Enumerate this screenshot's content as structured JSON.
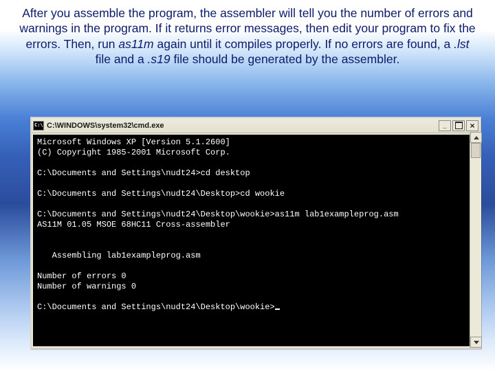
{
  "instruction": {
    "p1": "After you assemble the program, the assembler will tell you the number of errors and warnings in the program. If it returns error messages, then edit your program to fix the errors. Then, run ",
    "em1": "as11m",
    "p2": " again until it compiles properly. If no errors are found, a ",
    "em2": ".lst",
    "p3": " file and a ",
    "em3": ".s19",
    "p4": " file should be generated by the assembler."
  },
  "window": {
    "title": "C:\\WINDOWS\\system32\\cmd.exe",
    "buttons": {
      "min": "_",
      "close": "×"
    }
  },
  "terminal": {
    "l0": "Microsoft Windows XP [Version 5.1.2600]",
    "l1": "(C) Copyright 1985-2001 Microsoft Corp.",
    "l2": "C:\\Documents and Settings\\nudt24>cd desktop",
    "l3": "C:\\Documents and Settings\\nudt24\\Desktop>cd wookie",
    "l4": "C:\\Documents and Settings\\nudt24\\Desktop\\wookie>as11m lab1exampleprog.asm",
    "l5": "AS11M 01.05 MSOE 68HC11 Cross-assembler",
    "l6": "   Assembling lab1exampleprog.asm",
    "l7": "Number of errors 0",
    "l8": "Number of warnings 0",
    "l9": "C:\\Documents and Settings\\nudt24\\Desktop\\wookie>"
  }
}
